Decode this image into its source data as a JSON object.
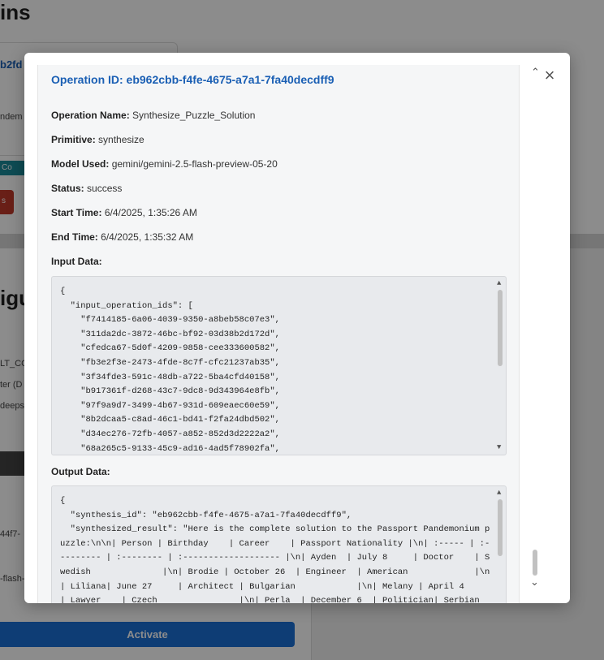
{
  "background": {
    "title_fragment": "ins",
    "subtitle_fragment": "igu",
    "link_fragment": "b2fd",
    "text_fragment": "ndem",
    "teal_button": "Co",
    "red_button": "s",
    "lines": [
      "LT_CO",
      "ter (D",
      "deeps",
      "44f7-",
      "-flash-"
    ],
    "activate_label": "Activate"
  },
  "modal": {
    "operation_id_label": "Operation ID: eb962cbb-f4fe-4675-a7a1-7fa40decdff9",
    "fields": [
      {
        "label": "Operation Name:",
        "value": "Synthesize_Puzzle_Solution"
      },
      {
        "label": "Primitive:",
        "value": "synthesize"
      },
      {
        "label": "Model Used:",
        "value": "gemini/gemini-2.5-flash-preview-05-20"
      },
      {
        "label": "Status:",
        "value": "success"
      },
      {
        "label": "Start Time:",
        "value": "6/4/2025, 1:35:26 AM"
      },
      {
        "label": "End Time:",
        "value": "6/4/2025, 1:35:32 AM"
      }
    ],
    "input_data_label": "Input Data:",
    "input_data_text": "{\n  \"input_operation_ids\": [\n    \"f7414185-6a06-4039-9350-a8beb58c07e3\",\n    \"311da2dc-3872-46bc-bf92-03d38b2d172d\",\n    \"cfedca67-5d0f-4209-9858-cee333600582\",\n    \"fb3e2f3e-2473-4fde-8c7f-cfc21237ab35\",\n    \"3f34fde3-591c-48db-a722-5ba4cfd40158\",\n    \"b917361f-d268-43c7-9dc8-9d343964e8fb\",\n    \"97f9a9d7-3499-4b67-931d-609eaec60e59\",\n    \"8b2dcaa5-c8ad-46c1-bd41-f2fa24dbd502\",\n    \"d34ec276-72fb-4057-a852-852d3d2222a2\",\n    \"68a265c5-9133-45c9-ad16-4ad5f78902fa\",",
    "output_data_label": "Output Data:",
    "output_data_text": "{\n  \"synthesis_id\": \"eb962cbb-f4fe-4675-a7a1-7fa40decdff9\",\n  \"synthesized_result\": \"Here is the complete solution to the Passport Pandemonium puzzle:\\n\\n| Person | Birthday    | Career    | Passport Nationality |\\n| :----- | :--------- | :-------- | :------------------- |\\n| Ayden  | July 8     | Doctor    | Swedish              |\\n| Brodie | October 26  | Engineer  | American             |\\n| Liliana| June 27     | Architect | Bulgarian            |\\n| Melany | April 4     | Lawyer    | Czech                |\\n| Perla  | December 6  | Politician| Serbian"
  }
}
